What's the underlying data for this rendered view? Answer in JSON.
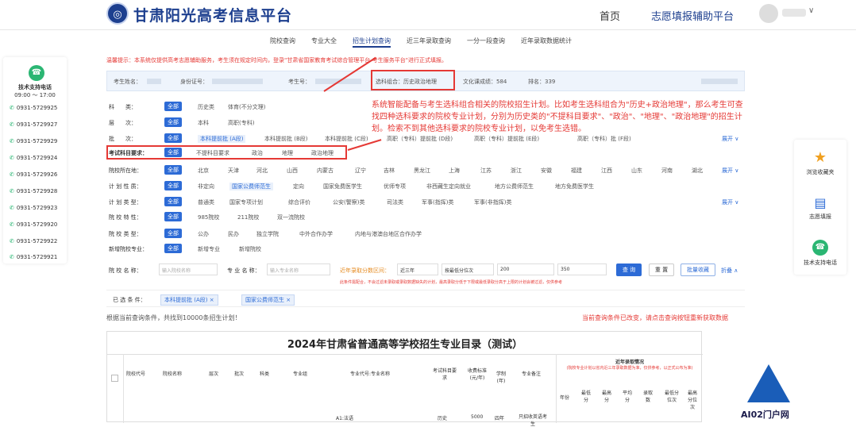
{
  "header": {
    "brand": "甘肃阳光高考信息平台",
    "nav_home": "首页",
    "nav_volunteer": "志愿填报辅助平台"
  },
  "subnav": [
    "院校查询",
    "专业大全",
    "招生计划查询",
    "近三年录取查询",
    "一分一段查询",
    "近年录取数据统计"
  ],
  "warning": "温馨提示：本系统仅提供高考志愿辅助服务，考生须在规定时间内，登录\"甘肃省国家教育考试综合管理平台-考生服务平台\"进行正式填报。",
  "support": {
    "title": "技术支持电话",
    "hours": "09:00 ～ 17:00",
    "phones": [
      "0931-5729925",
      "0931-5729927",
      "0931-5729929",
      "0931-5729924",
      "0931-5729926",
      "0931-5729928",
      "0931-5729923",
      "0931-5729920",
      "0931-5729922",
      "0931-5729921"
    ]
  },
  "info": {
    "name_label": "考生姓名：",
    "id_label": "身份证号：",
    "exam_label": "考生号：",
    "subject_combo": "选科组合：历史政治地理",
    "score": "文化课成绩：584",
    "rank": "排名：339"
  },
  "filters": {
    "category": {
      "label": "科　　类：",
      "options": [
        "全部",
        "历史类",
        "体育(不分文理)"
      ]
    },
    "level": {
      "label": "层　　次：",
      "options": [
        "全部",
        "本科",
        "高职(专科)"
      ]
    },
    "batch": {
      "label": "批　　次：",
      "options": [
        "全部",
        "本科提前批 (A段)",
        "本科提前批 (B段)",
        "本科提前批 (C段)",
        "高职（专科）提前批 (D段)",
        "高职（专科）提前批 (E段)",
        "高职（专科）批 (F段)"
      ],
      "more": "展开 ∨"
    },
    "subject_req": {
      "label": "考试科目要求：",
      "options": [
        "全部",
        "不提科目要求",
        "政治",
        "地理",
        "政治地理"
      ]
    },
    "location": {
      "label": "院校所在地：",
      "options": [
        "全部",
        "北京",
        "天津",
        "河北",
        "山西",
        "内蒙古",
        "辽宁",
        "吉林",
        "黑龙江",
        "上海",
        "江苏",
        "浙江",
        "安徽",
        "福建",
        "江西",
        "山东",
        "河南",
        "湖北"
      ],
      "more": "展开 ∨"
    },
    "plan_nature": {
      "label": "计 划 性 质：",
      "options": [
        "全部",
        "非定向",
        "国家公费师范生",
        "定向",
        "国家免费医学生",
        "优师专项",
        "非西藏生定向就业",
        "地方公费师范生",
        "地方免费医学生"
      ]
    },
    "plan_type": {
      "label": "计 划 类 型：",
      "options": [
        "全部",
        "普通类",
        "国家专项计划",
        "综合评价",
        "公安(警察)类",
        "司法类",
        "军事(指挥)类",
        "军事(非指挥)类"
      ],
      "more": "展开 ∨"
    },
    "school_feature": {
      "label": "院 校 特 性：",
      "options": [
        "全部",
        "985院校",
        "211院校",
        "双一流院校"
      ]
    },
    "school_type": {
      "label": "院 校 类 型：",
      "options": [
        "全部",
        "公办",
        "民办",
        "独立学院",
        "中外合作办学",
        "内地与港澳台地区合作办学"
      ]
    },
    "new_school": {
      "label": "新增院校专业：",
      "options": [
        "全部",
        "新增专业",
        "新增院校"
      ]
    }
  },
  "search": {
    "school_label": "院 校 名 称：",
    "school_placeholder": "输入院校名称",
    "major_label": "专 业 名 称：",
    "major_placeholder": "输入专业名称",
    "range_label": "近年录取分数区间：",
    "years": "近三年",
    "metric": "按最低分位次",
    "min": "200",
    "max": "350",
    "query": "查 询",
    "reset": "重 置",
    "batch_fav": "批量收藏",
    "collapse": "折叠 ∧",
    "tip": "此条件需配合，不会过滤未录取或录取数据缺失的计划，最高录取分低于下限或最低录取分高于上限的计划会被过滤，仅供参考"
  },
  "selected": {
    "label": "已 选 条 件：",
    "tags": [
      "本科提前批 (A段) ×",
      "国家公费师范生 ×"
    ]
  },
  "results": {
    "count_text": "根据当前查询条件，共找到10000条招生计划！",
    "changed_text": "当前查询条件已改变，请点击查询按钮重新获取数据"
  },
  "table": {
    "title": "2024年甘肃省普通高等学校招生专业目录（测试）",
    "headers": [
      "院校代号",
      "院校名称",
      "层次",
      "批次",
      "科类",
      "专业组",
      "专业代号:专业名称",
      "考试科目要求",
      "收费标准(元/年)",
      "学制(年)",
      "专业备注"
    ],
    "history_title": "近年录取情况",
    "history_note": "(院校专业计划以省内近三年录取数据为准，仅供参考，以正式公布为准)",
    "history_headers": [
      "年份",
      "最低分",
      "最高分",
      "平均分",
      "录取数",
      "最低分位次",
      "最高分位次"
    ],
    "first_row": {
      "major": "A1:法语",
      "req": "历史",
      "fee": "5000",
      "years": "四年",
      "remark": "只招收英语考生"
    }
  },
  "annotation": "系统智能配备与考生选科组合相关的院校招生计划。比如考生选科组合为\"历史+政治地理\"，那么考生可查找四种选科要求的院校专业计划，分别为历史类的\"不提科目要求\"、\"政治\"、\"地理\"、\"政治地理\"的招生计划。检索不到其他选科要求的院校专业计划，以免考生选错。",
  "right_sidebar": [
    "浏览收藏夹",
    "志愿填报",
    "技术支持电话"
  ],
  "watermark": "AI02门户网",
  "colors": {
    "brand": "#1d3f8f",
    "accent": "#2d6bd6",
    "alert": "#e53935"
  }
}
